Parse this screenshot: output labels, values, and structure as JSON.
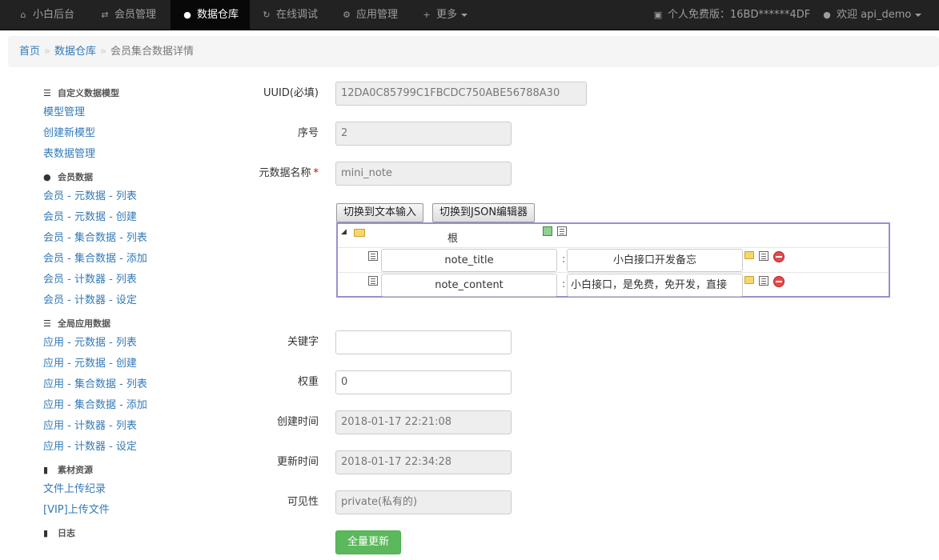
{
  "navbar": {
    "brand": "小白后台",
    "items": [
      {
        "label": "会员管理"
      },
      {
        "label": "数据仓库"
      },
      {
        "label": "在线调试"
      },
      {
        "label": "应用管理"
      },
      {
        "label": "更多"
      }
    ],
    "license": "个人免费版：16BD******4DF",
    "welcome": "欢迎 api_demo"
  },
  "breadcrumb": {
    "home": "首页",
    "section": "数据仓库",
    "current": "会员集合数据详情",
    "separator": "»"
  },
  "sidebar": {
    "groups": [
      {
        "title": "自定义数据模型",
        "items": [
          "模型管理",
          "创建新模型",
          "表数据管理"
        ]
      },
      {
        "title": "会员数据",
        "items": [
          "会员 - 元数据 - 列表",
          "会员 - 元数据 - 创建",
          "会员 - 集合数据 - 列表",
          "会员 - 集合数据 - 添加",
          "会员 - 计数器 - 列表",
          "会员 - 计数器 - 设定"
        ]
      },
      {
        "title": "全局应用数据",
        "items": [
          "应用 - 元数据 - 列表",
          "应用 - 元数据 - 创建",
          "应用 - 集合数据 - 列表",
          "应用 - 集合数据 - 添加",
          "应用 - 计数器 - 列表",
          "应用 - 计数器 - 设定"
        ]
      },
      {
        "title": "素材资源",
        "items": [
          "文件上传纪录",
          "[VIP]上传文件"
        ]
      },
      {
        "title": "日志",
        "items": []
      }
    ]
  },
  "form": {
    "uuid": {
      "label": "UUID(必填)",
      "value": "12DA0C85799C1FBCDC750ABE56788A30"
    },
    "seq": {
      "label": "序号",
      "value": "2"
    },
    "meta_name": {
      "label": "元数据名称",
      "required": "*",
      "value": "mini_note"
    },
    "switch_text": "切换到文本输入",
    "switch_json": "切换到JSON编辑器",
    "json": {
      "root_label": "根",
      "colon": ":",
      "rows": [
        {
          "key": "note_title",
          "value": "小白接口开发备忘"
        },
        {
          "key": "note_content",
          "value": "小白接口，是免费，免开发，直接"
        }
      ]
    },
    "keyword": {
      "label": "关键字",
      "value": ""
    },
    "weight": {
      "label": "权重",
      "value": "0"
    },
    "created": {
      "label": "创建时间",
      "value": "2018-01-17 22:21:08"
    },
    "updated": {
      "label": "更新时间",
      "value": "2018-01-17 22:34:28"
    },
    "visibility": {
      "label": "可见性",
      "value": "private(私有的)"
    },
    "submit": "全量更新"
  }
}
